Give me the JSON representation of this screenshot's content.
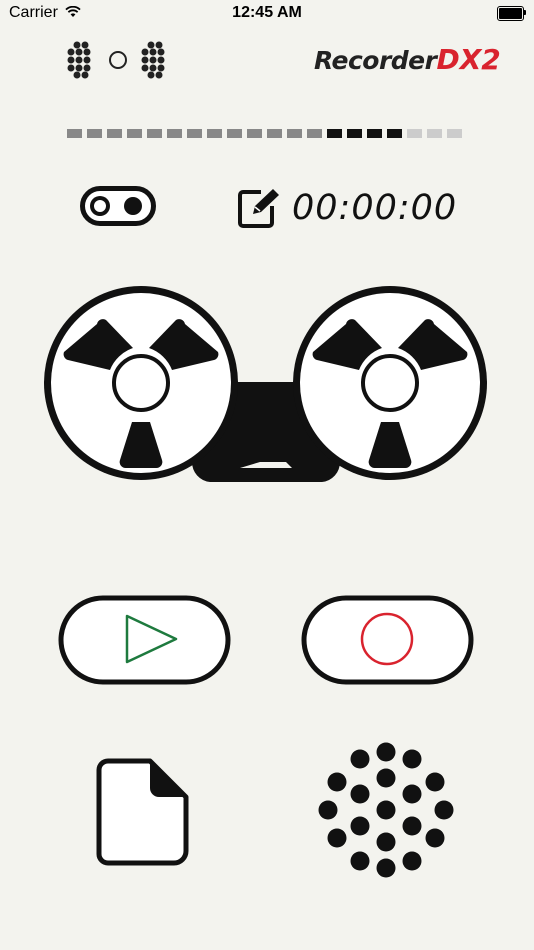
{
  "status_bar": {
    "carrier": "Carrier",
    "time": "12:45 AM"
  },
  "header": {
    "logo": {
      "word": "Recorder",
      "accent": "DX2",
      "accent_color": "#d9232e"
    },
    "left_icon": "speaker-dots-icon"
  },
  "level_meter": {
    "segments": [
      "#888888",
      "#888888",
      "#888888",
      "#888888",
      "#888888",
      "#888888",
      "#888888",
      "#888888",
      "#888888",
      "#888888",
      "#888888",
      "#888888",
      "#888888",
      "#111111",
      "#111111",
      "#111111",
      "#111111",
      "#cccccc",
      "#cccccc",
      "#cccccc"
    ]
  },
  "controls": {
    "toggle_icon": "toggle-switch-icon",
    "edit_icon": "edit-icon",
    "elapsed_time": "00:00:00"
  },
  "tape": {
    "icon": "reel-to-reel-tape-icon"
  },
  "buttons": {
    "play": {
      "icon": "play-icon",
      "color": "#1e7a3e"
    },
    "record": {
      "icon": "record-icon",
      "color": "#d9232e"
    },
    "files": {
      "icon": "document-icon"
    },
    "speaker": {
      "icon": "speaker-grille-icon"
    }
  }
}
